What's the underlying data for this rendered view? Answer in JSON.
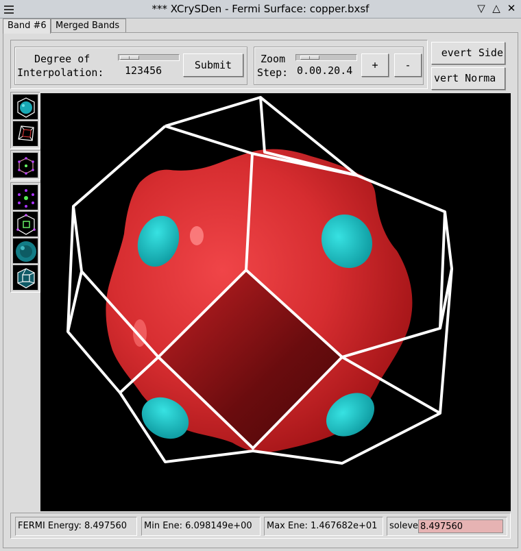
{
  "window": {
    "title": "*** XCrySDen - Fermi Surface: copper.bxsf",
    "shade_glyph": "▽",
    "maximize_glyph": "△",
    "close_glyph": "✕"
  },
  "tabs": [
    {
      "label": "Band #6",
      "active": true
    },
    {
      "label": "Merged Bands",
      "active": false
    }
  ],
  "interpolation": {
    "label_line1": "Degree of",
    "label_line2": "Interpolation:",
    "scale_ticks": "123456",
    "submit_label": "Submit"
  },
  "zoom": {
    "label_line1": "Zoom",
    "label_line2": "Step:",
    "scale_ticks": "0.00.20.4",
    "plus_label": "+",
    "minus_label": "-"
  },
  "side_buttons": {
    "revert_sides_label": "evert Side",
    "revert_normals_label": "vert Norma"
  },
  "toolbar": {
    "icons": [
      "fermi-surface-cell-icon",
      "reciprocal-cell-icon",
      "brillouin-zone-icon",
      "kpoint-dots-icon",
      "zone-with-surface-icon",
      "smooth-surface-icon",
      "wigner-seitz-cell-icon"
    ]
  },
  "status": {
    "fermi_energy": "FERMI Energy: 8.497560",
    "min_energy": "Min Ene: 6.098149e+00",
    "max_energy": "Max Ene: 1.467682e+01",
    "isolevel_label": "solevel",
    "isolevel_value": "8.497560"
  },
  "colors": {
    "surface_outer": "#e8383b",
    "surface_inner": "#19c3c3",
    "cell_edges": "#ffffff",
    "background": "#000000",
    "isolevel_field": "#e6b3b3"
  }
}
